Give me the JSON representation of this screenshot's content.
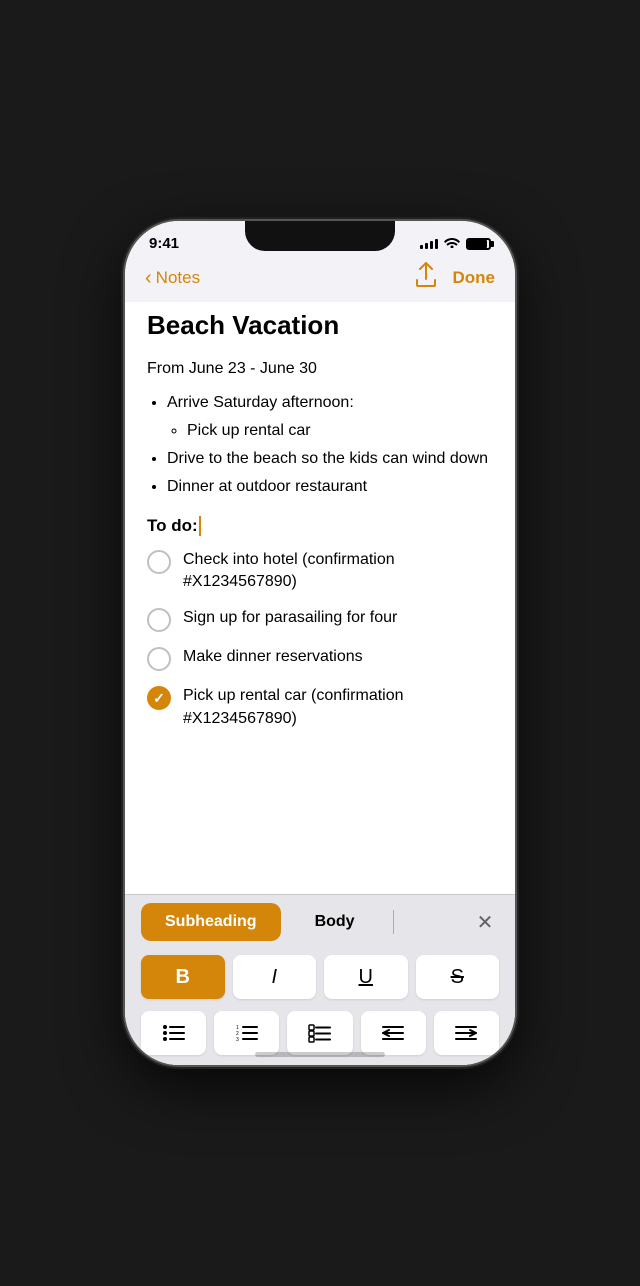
{
  "status": {
    "time": "9:41",
    "signal_bars": [
      4,
      6,
      8,
      10,
      12
    ],
    "battery_percent": 90
  },
  "nav": {
    "back_label": "Notes",
    "done_label": "Done"
  },
  "note": {
    "title": "Beach Vacation",
    "date_range": "From June 23 - June 30",
    "bullet_items": [
      {
        "text": "Arrive Saturday afternoon:",
        "sub_items": [
          "Pick up rental car"
        ]
      },
      {
        "text": "Drive to the beach so the kids can wind down",
        "sub_items": []
      },
      {
        "text": "Dinner at outdoor restaurant",
        "sub_items": []
      }
    ],
    "todo_header": "To do:",
    "todo_items": [
      {
        "id": 1,
        "text": "Check into hotel (confirmation #X1234567890)",
        "checked": false
      },
      {
        "id": 2,
        "text": "Sign up for parasailing for four",
        "checked": false
      },
      {
        "id": 3,
        "text": "Make dinner reservations",
        "checked": false
      },
      {
        "id": 4,
        "text": "Pick up rental car (confirmation #X1234567890)",
        "checked": true
      }
    ]
  },
  "formatting": {
    "style_buttons": [
      "Subheading",
      "Body"
    ],
    "active_style": "Subheading",
    "format_buttons": [
      "B",
      "I",
      "U",
      "S"
    ],
    "active_format": "B",
    "list_buttons": [
      "unordered-list",
      "numbered-list",
      "checklist",
      "indent-left",
      "indent-right"
    ]
  }
}
